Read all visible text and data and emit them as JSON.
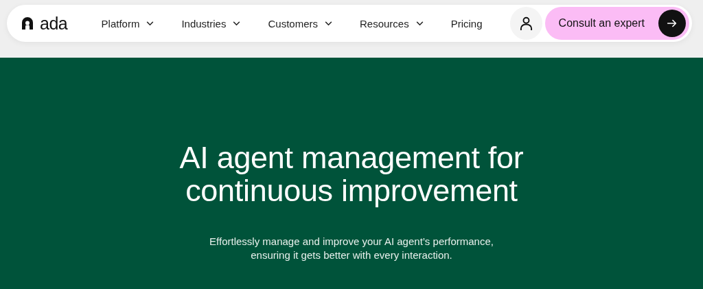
{
  "header": {
    "logo": {
      "text": "ada"
    },
    "nav_items": [
      {
        "label": "Platform",
        "has_dropdown": true
      },
      {
        "label": "Industries",
        "has_dropdown": true
      },
      {
        "label": "Customers",
        "has_dropdown": true
      },
      {
        "label": "Resources",
        "has_dropdown": true
      },
      {
        "label": "Pricing",
        "has_dropdown": false
      }
    ],
    "cta": {
      "label": "Consult an expert"
    }
  },
  "hero": {
    "title_lines": [
      "AI agent management for",
      "continuous improvement"
    ],
    "subtitle": "Effortlessly manage and improve your AI agent’s performance, ensuring it gets better with every interaction."
  }
}
